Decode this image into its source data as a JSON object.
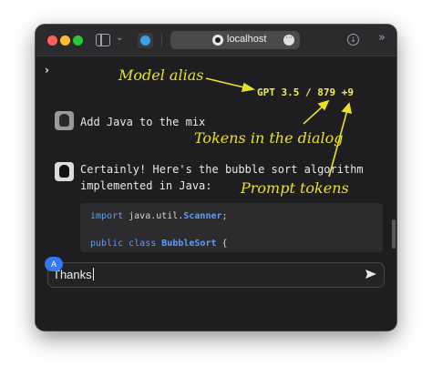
{
  "browser": {
    "url": "localhost"
  },
  "chat": {
    "user_message": "Add Java to the mix",
    "bot_message_line1": "Certainly! Here's the bubble sort algorithm",
    "bot_message_line2": "implemented in Java:",
    "code": {
      "line1_kw": "import",
      "line1_pkg": " java.util.",
      "line1_cls": "Scanner",
      "line1_end": ";",
      "line2_kw": "public class",
      "line2_cls": "BubbleSort",
      "line2_end": " {"
    }
  },
  "composer": {
    "text": "Thanks",
    "badge": "A"
  },
  "status": {
    "model_tokens": "GPT 3.5 / 879 +9"
  },
  "annotations": {
    "model_alias": "Model alias",
    "tokens_dialog": "Tokens in the dialog",
    "prompt_tokens": "Prompt tokens"
  },
  "colors": {
    "annotation": "#e8e02a",
    "accent": "#3478f6"
  }
}
